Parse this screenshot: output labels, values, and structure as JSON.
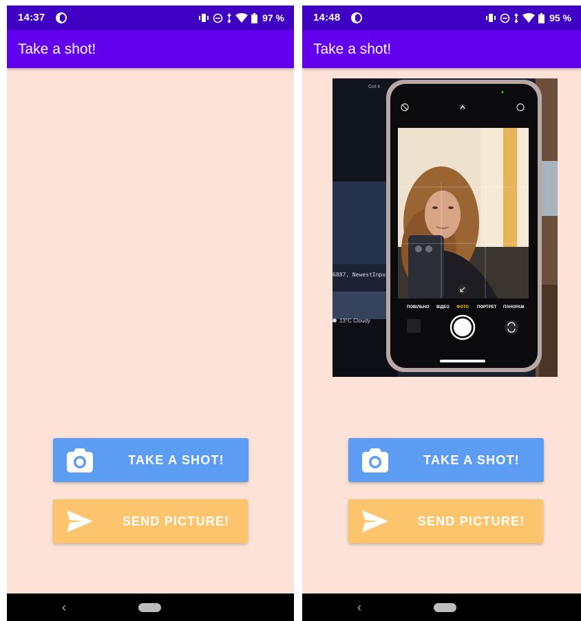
{
  "screens": [
    {
      "status_bar": {
        "time": "14:37",
        "battery": "97 %"
      },
      "app_bar": {
        "title": "Take a shot!"
      },
      "buttons": {
        "take_label": "TAKE A SHOT!",
        "send_label": "SEND PICTURE!"
      },
      "nav_bar": {
        "back_glyph": "‹"
      }
    },
    {
      "status_bar": {
        "time": "14:48",
        "battery": "95 %"
      },
      "app_bar": {
        "title": "Take a shot!"
      },
      "photo": {
        "caption_top": "Got it",
        "terminal_text": "6887, NewestInput",
        "weather_text": "13°C Cloudy",
        "camera_modes": [
          "ПОВІЛЬНО",
          "ВІДЕО",
          "ФОТО",
          "ПОРТРЕТ",
          "ПАНОРАМ"
        ]
      },
      "buttons": {
        "take_label": "TAKE A SHOT!",
        "send_label": "SEND PICTURE!"
      },
      "nav_bar": {
        "back_glyph": "‹"
      }
    }
  ],
  "colors": {
    "status_bar": "#3f00c4",
    "app_bar": "#6200ee",
    "background": "#fde3d7",
    "take_button": "#5c9cf3",
    "send_button": "#fcc46c",
    "nav_bar": "#000000"
  },
  "icons": {
    "app_notification": "app-notification-icon",
    "vibrate": "vibrate-icon",
    "dnd": "do-not-disturb-icon",
    "data": "data-arrows-icon",
    "wifi": "wifi-icon",
    "battery": "battery-icon",
    "camera": "camera-icon",
    "send": "send-icon",
    "back": "back-icon",
    "home": "home-pill-icon"
  }
}
